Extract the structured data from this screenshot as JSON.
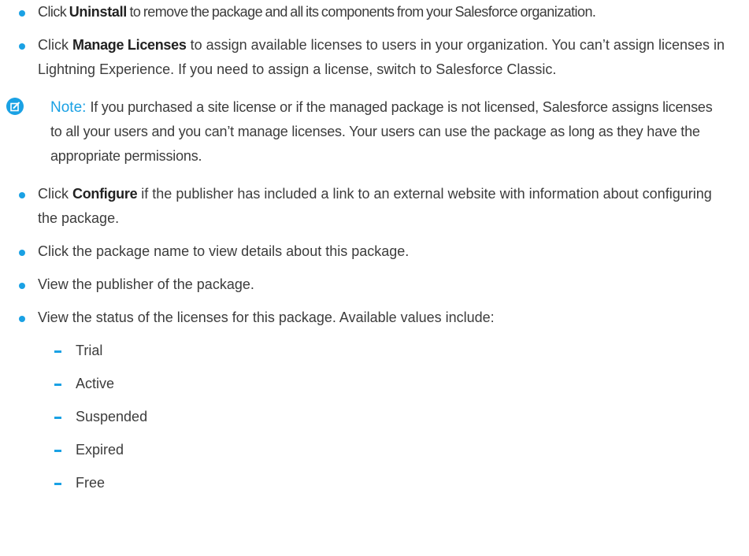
{
  "items": [
    {
      "prefix": "Click ",
      "bold": "Uninstall",
      "rest": " to remove the package and all its components from your Salesforce organization."
    },
    {
      "prefix": "Click ",
      "bold": "Manage Licenses",
      "rest": " to assign available licenses to users in your organization. You can’t assign licenses in Lightning Experience. If you need to assign a license, switch to Salesforce Classic."
    },
    {
      "prefix": "Click ",
      "bold": "Configure",
      "rest": " if the publisher has included a link to an external website with information about configuring the package."
    },
    {
      "text": "Click the package name to view details about this package."
    },
    {
      "text": "View the publisher of the package."
    },
    {
      "text": "View the status of the licenses for this package. Available values include:"
    }
  ],
  "note": {
    "label": "Note:",
    "text": "If you purchased a site license or if the managed package is not licensed, Salesforce assigns licenses to all your users and you can’t manage licenses. Your users can use the package as long as they have the appropriate permissions.",
    "icon": "note-edit-icon"
  },
  "status_values": [
    "Trial",
    "Active",
    "Suspended",
    "Expired",
    "Free"
  ],
  "colors": {
    "accent": "#1aa1e4",
    "text": "#3c3c3c"
  }
}
